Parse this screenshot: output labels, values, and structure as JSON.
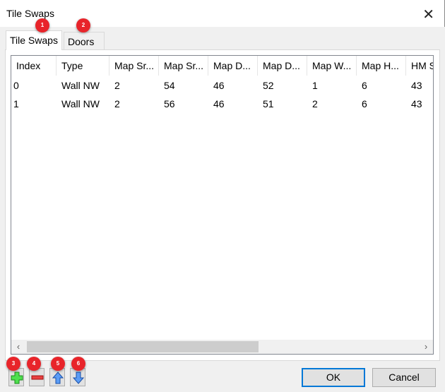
{
  "window": {
    "title": "Tile Swaps",
    "close_icon": "close-icon"
  },
  "tabs": [
    {
      "label": "Tile Swaps",
      "active": true
    },
    {
      "label": "Doors",
      "active": false
    }
  ],
  "table": {
    "columns": [
      "Index",
      "Type",
      "Map Sr...",
      "Map Sr...",
      "Map D...",
      "Map D...",
      "Map W...",
      "Map H...",
      "HM S"
    ],
    "rows": [
      [
        "0",
        "Wall NW",
        "2",
        "54",
        "46",
        "52",
        "1",
        "6",
        "43"
      ],
      [
        "1",
        "Wall NW",
        "2",
        "56",
        "46",
        "51",
        "2",
        "6",
        "43"
      ]
    ],
    "scroll_left": "‹",
    "scroll_right": "›"
  },
  "toolbar": {
    "add": "plus-icon",
    "remove": "minus-icon",
    "up": "arrow-up-icon",
    "down": "arrow-down-icon"
  },
  "buttons": {
    "ok": "OK",
    "cancel": "Cancel"
  },
  "badges": [
    "1",
    "2",
    "3",
    "4",
    "5",
    "6"
  ],
  "colors": {
    "badge": "#e8242a",
    "focus": "#0078d7",
    "add": "#33cc33",
    "remove": "#e03030",
    "arrow": "#3b7ee8"
  }
}
